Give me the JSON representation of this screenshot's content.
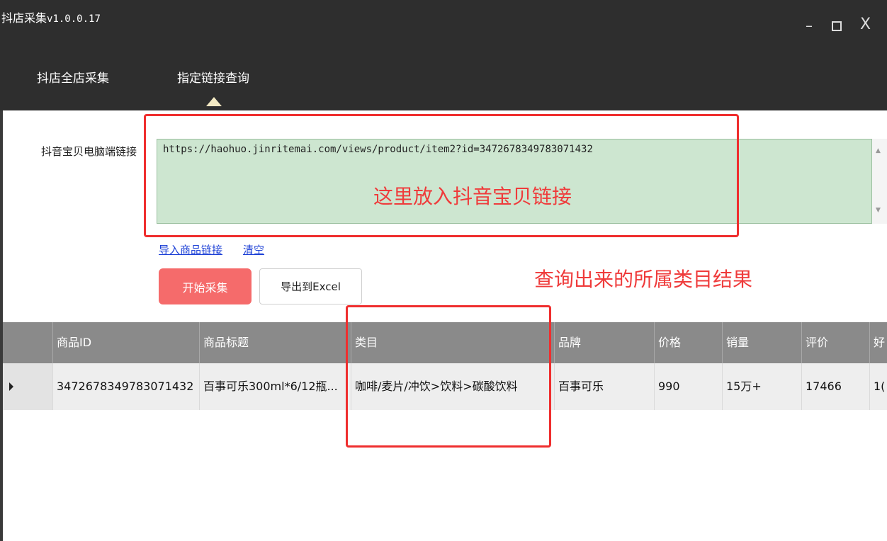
{
  "window": {
    "app_name": "抖店采集",
    "version": "v1.0.0.17",
    "minimize_glyph": "–",
    "close_glyph": "X"
  },
  "tabs": [
    {
      "label": "抖店全店采集",
      "active": false
    },
    {
      "label": "指定链接查询",
      "active": true
    }
  ],
  "form": {
    "link_label": "抖音宝贝电脑端链接",
    "link_value": "https://haohuo.jinritemai.com/views/product/item2?id=3472678349783071432",
    "import_link": "导入商品链接",
    "clear_link": "清空",
    "start_button": "开始采集",
    "export_button": "导出到Excel"
  },
  "annotations": {
    "link_hint": "这里放入抖音宝贝链接",
    "result_hint": "查询出来的所属类目结果",
    "color": "#ef2e2e"
  },
  "table": {
    "headers": [
      "商品ID",
      "商品标题",
      "类目",
      "品牌",
      "价格",
      "销量",
      "评价",
      "好"
    ],
    "rows": [
      [
        "3472678349783071432",
        "百事可乐300ml*6/12瓶...",
        "咖啡/麦片/冲饮>饮料>碳酸饮料",
        "百事可乐",
        "990",
        "15万+",
        "17466",
        "1("
      ]
    ]
  },
  "colors": {
    "titlebar": "#2e2e2e",
    "url_box": "#cde6d0",
    "start_button": "#f56b6b",
    "table_header": "#8a8a8a",
    "link": "#1b3fd6"
  }
}
